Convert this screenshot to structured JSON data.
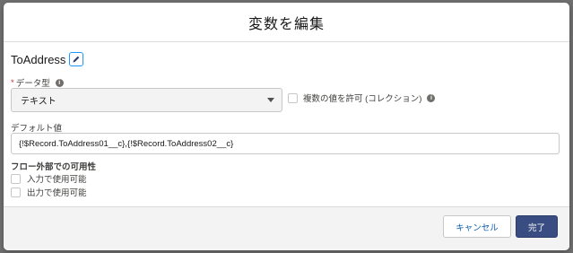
{
  "modal": {
    "title": "変数を編集"
  },
  "variable": {
    "name": "ToAddress"
  },
  "datatype": {
    "required_mark": "*",
    "label": "データ型",
    "selected": "テキスト"
  },
  "multi": {
    "label": "複数の値を許可 (コレクション)"
  },
  "default_value": {
    "label": "デフォルト値",
    "value": "{!$Record.ToAddress01__c},{!$Record.ToAddress02__c}"
  },
  "availability": {
    "title": "フロー外部での可用性",
    "input_label": "入力で使用可能",
    "output_label": "出力で使用可能"
  },
  "footer": {
    "cancel_label": "キャンセル",
    "done_label": "完了"
  },
  "colors": {
    "primary_button": "#3a4d82",
    "link": "#0b5cab",
    "required": "#c23934"
  }
}
